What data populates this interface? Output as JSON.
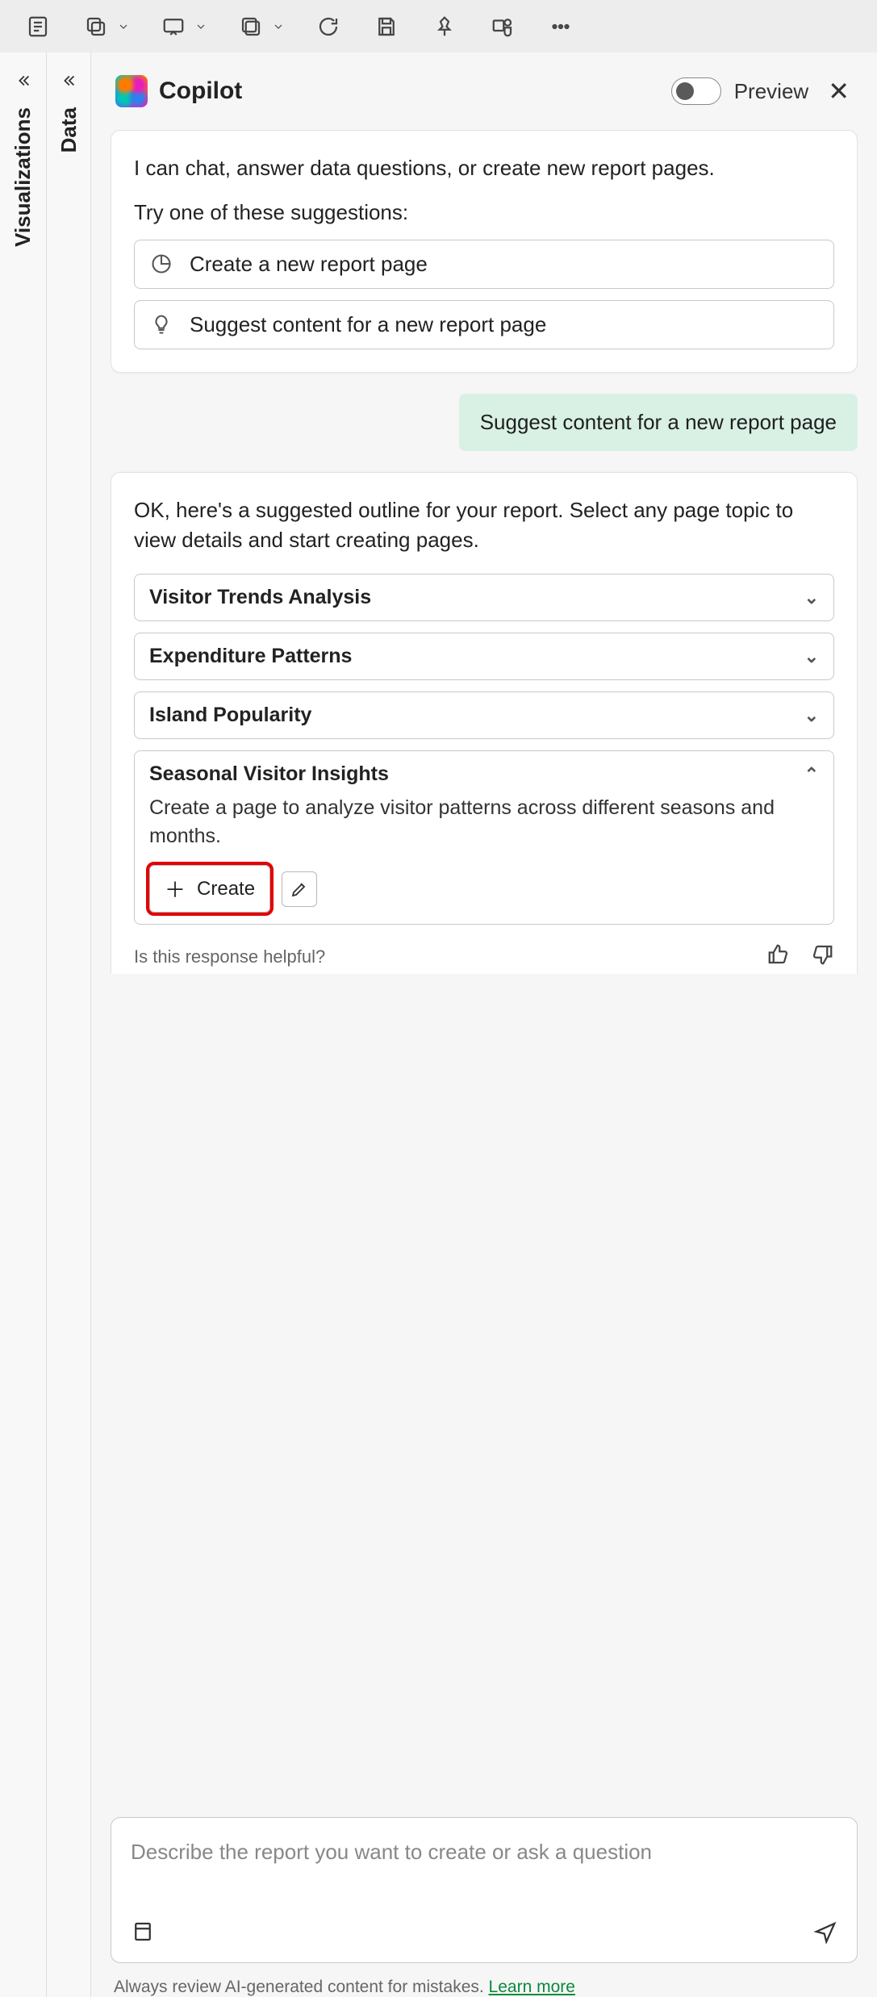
{
  "ribbon": {
    "items": [
      "outline",
      "copy",
      "chev1",
      "present",
      "chev2",
      "duplicate",
      "chev3",
      "refresh",
      "save",
      "pin",
      "teams",
      "more"
    ]
  },
  "rails": {
    "visualizations": "Visualizations",
    "data": "Data"
  },
  "copilot": {
    "title": "Copilot",
    "preview": "Preview",
    "intro": "I can chat, answer data questions, or create new report pages.",
    "try": "Try one of these suggestions:",
    "suggestion1": "Create a new report page",
    "suggestion2": "Suggest content for a new report page"
  },
  "user_message": "Suggest content for a new report page",
  "response": {
    "intro": "OK, here's a suggested outline for your report. Select any page topic to view details and start creating pages.",
    "topics": [
      {
        "title": "Visitor Trends Analysis"
      },
      {
        "title": "Expenditure Patterns"
      },
      {
        "title": "Island Popularity"
      },
      {
        "title": "Seasonal Visitor Insights",
        "description": "Create a page to analyze visitor patterns across different seasons and months.",
        "create_label": "Create"
      }
    ],
    "feedback_q": "Is this response helpful?"
  },
  "composer": {
    "placeholder": "Describe the report you want to create or ask a question"
  },
  "disclaimer": {
    "text": "Always review AI-generated content for mistakes. ",
    "link": "Learn more"
  }
}
